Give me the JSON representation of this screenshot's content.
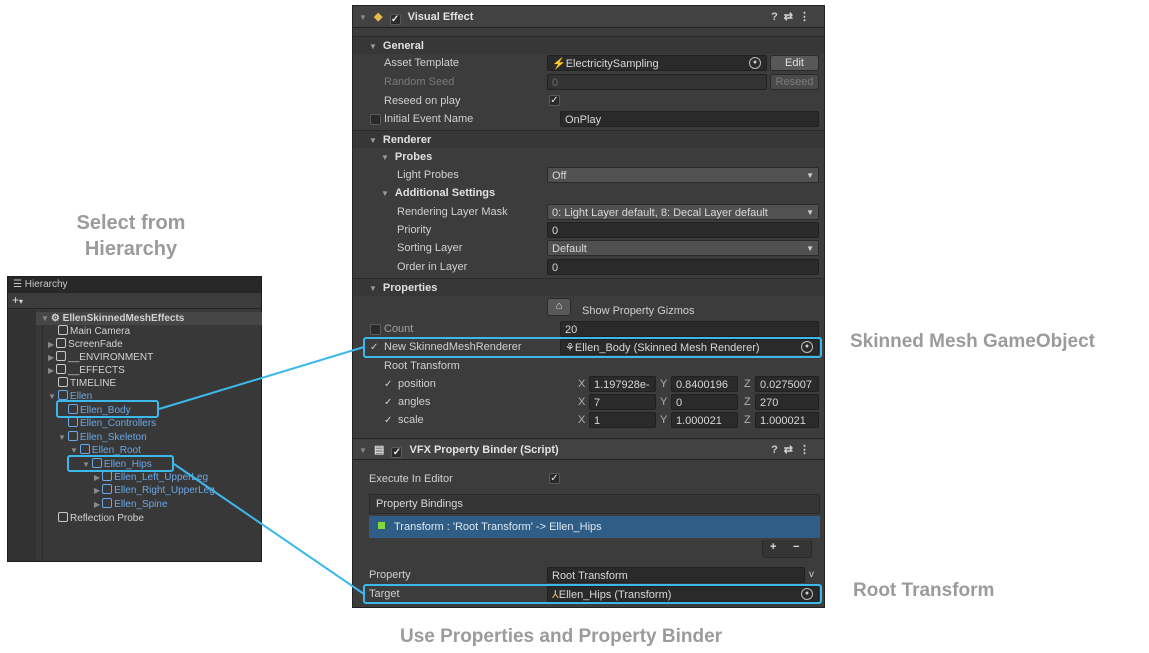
{
  "captions": {
    "select_from": "Select from",
    "hierarchy": "Hierarchy",
    "skinned_mesh": "Skinned Mesh GameObject",
    "root_transform": "Root Transform",
    "use_properties": "Use Properties and Property Binder"
  },
  "hierarchy": {
    "tab": "Hierarchy",
    "add": "+",
    "scene": "EllenSkinnedMeshEffects",
    "items": [
      "Main Camera",
      "ScreenFade",
      "__ENVIRONMENT",
      "__EFFECTS",
      "TIMELINE",
      "Ellen",
      "Ellen_Body",
      "Ellen_Controllers",
      "Ellen_Skeleton",
      "Ellen_Root",
      "Ellen_Hips",
      "Ellen_Left_UpperLeg",
      "Ellen_Right_UpperLeg",
      "Ellen_Spine",
      "Reflection Probe"
    ]
  },
  "visual_effect": {
    "title": "Visual Effect",
    "general": "General",
    "asset_template_label": "Asset Template",
    "asset_template_value": "ElectricitySampling",
    "edit": "Edit",
    "random_seed_label": "Random Seed",
    "random_seed_value": "0",
    "reseed": "Reseed",
    "reseed_on_play": "Reseed on play",
    "initial_event_label": "Initial Event Name",
    "initial_event_value": "OnPlay",
    "renderer": "Renderer",
    "probes": "Probes",
    "light_probes_label": "Light Probes",
    "light_probes_value": "Off",
    "additional_settings": "Additional Settings",
    "rendering_layer_label": "Rendering Layer Mask",
    "rendering_layer_value": "0: Light Layer default, 8: Decal Layer default",
    "priority_label": "Priority",
    "priority_value": "0",
    "sorting_layer_label": "Sorting Layer",
    "sorting_layer_value": "Default",
    "order_label": "Order in Layer",
    "order_value": "0",
    "properties": "Properties",
    "show_gizmos": "Show Property Gizmos",
    "count_label": "Count",
    "count_value": "20",
    "smr_label": "New SkinnedMeshRenderer",
    "smr_value": "Ellen_Body (Skinned Mesh Renderer)",
    "root_transform_label": "Root Transform",
    "position_label": "position",
    "position": {
      "x": "1.197928e-",
      "y": "0.8400196",
      "z": "0.0275007"
    },
    "angles_label": "angles",
    "angles": {
      "x": "7",
      "y": "0",
      "z": "270"
    },
    "scale_label": "scale",
    "scale": {
      "x": "1",
      "y": "1.000021",
      "z": "1.000021"
    },
    "axes": {
      "x": "X",
      "y": "Y",
      "z": "Z"
    }
  },
  "binder": {
    "title": "VFX Property Binder (Script)",
    "execute_label": "Execute In Editor",
    "bindings_header": "Property Bindings",
    "binding_row": "Transform : 'Root Transform' -> Ellen_Hips",
    "plus": "+",
    "minus": "−",
    "property_label": "Property",
    "property_value": "Root Transform",
    "target_label": "Target",
    "target_value": "Ellen_Hips (Transform)"
  },
  "colors": {
    "highlight": "#3cb9ea",
    "selection": "#2f5d86",
    "binding_green": "#7fdc3c"
  }
}
